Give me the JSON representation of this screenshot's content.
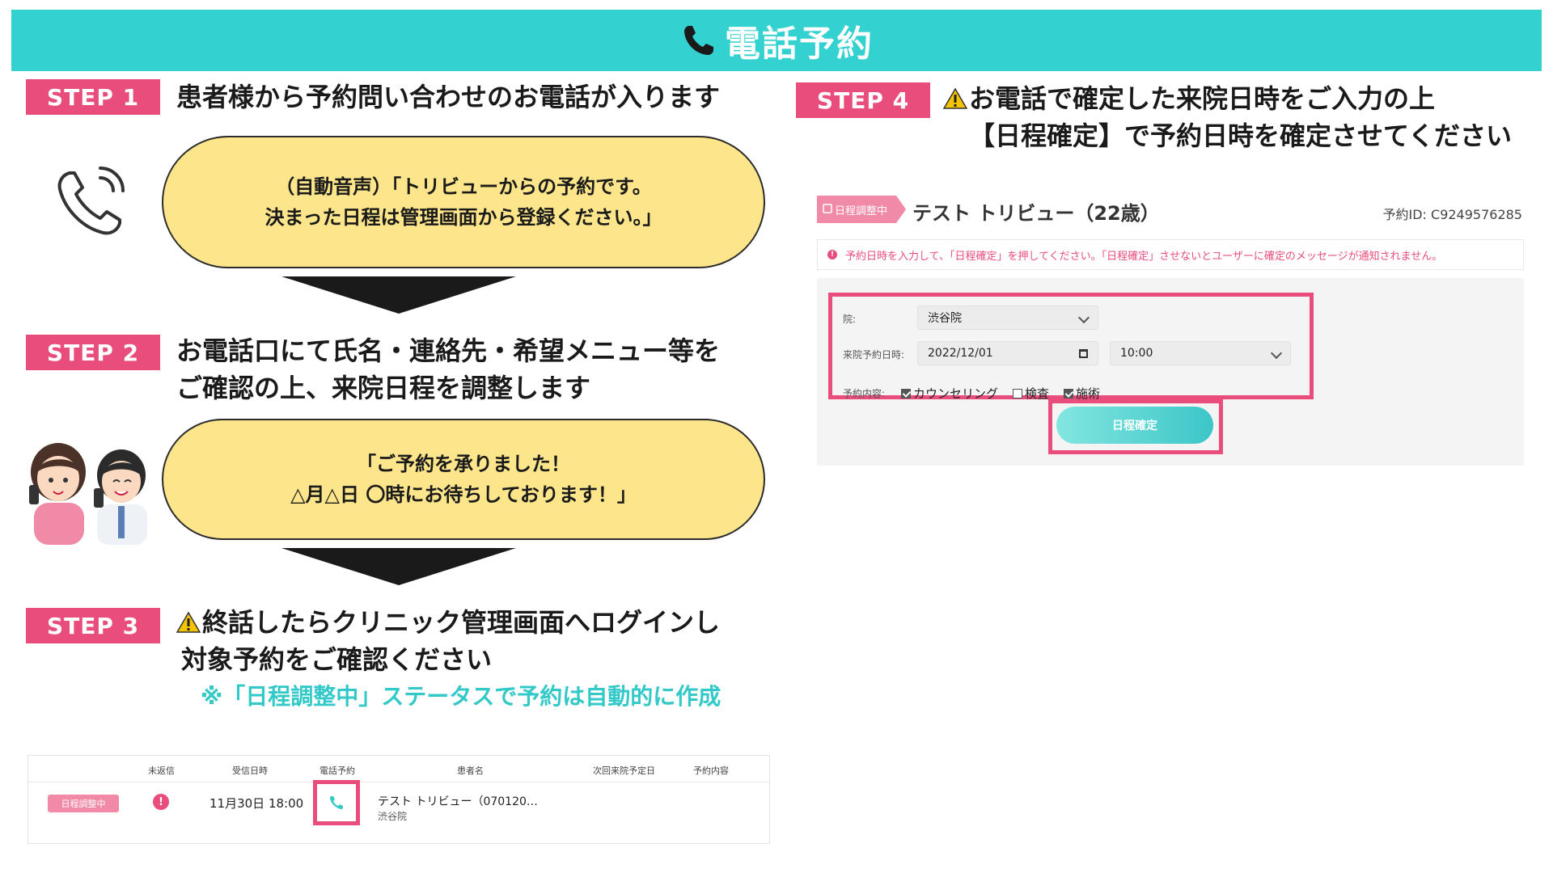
{
  "banner": {
    "title": "電話予約"
  },
  "steps": [
    {
      "badge": "STEP 1",
      "lines": [
        "患者様から予約問い合わせのお電話が入ります"
      ]
    },
    {
      "badge": "STEP 2",
      "lines": [
        "お電話口にて氏名・連絡先・希望メニュー等を",
        "ご確認の上、来院日程を調整します"
      ]
    },
    {
      "badge": "STEP 3",
      "lines": [
        "終話したらクリニック管理画面へログインし",
        "対象予約をご確認ください"
      ],
      "note": "※「日程調整中」ステータスで予約は自動的に作成"
    },
    {
      "badge": "STEP 4",
      "lines": [
        "お電話で確定した来院日時をご入力の上",
        "【日程確定】で予約日時を確定させてください"
      ]
    }
  ],
  "bubbles": [
    {
      "lines": [
        "（自動音声）「トリビューからの予約です。",
        "決まった日程は管理画面から登録ください。」"
      ]
    },
    {
      "lines": [
        "「ご予約を承りました！",
        "△月△日 〇時にお待ちしております！」"
      ]
    }
  ],
  "table": {
    "headers": [
      "未返信",
      "受信日時",
      "電話予約",
      "患者名",
      "次回来院予定日",
      "予約内容"
    ],
    "row": {
      "status": "日程調整中",
      "alert": "!",
      "received": "11月30日 18:00",
      "patient": "テスト トリビュー（070120…",
      "clinic": "渋谷院"
    }
  },
  "form": {
    "status_tag": "日程調整中",
    "patient_name": "テスト トリビュー（22歳）",
    "reservation_id": "予約ID: C9249576285",
    "alert_message": "予約日時を入力して、「日程確定」を押してください。「日程確定」させないとユーザーに確定のメッセージが通知されません。",
    "clinic_label": "院:",
    "clinic_value": "渋谷院",
    "date_label": "来院予約日時:",
    "date_value": "2022/12/01",
    "time_value": "10:00",
    "content_label": "予約内容:",
    "options": [
      {
        "label": "カウンセリング",
        "checked": true
      },
      {
        "label": "検査",
        "checked": false
      },
      {
        "label": "施術",
        "checked": true
      }
    ],
    "confirm_label": "日程確定"
  },
  "colors": {
    "teal": "#33d1cf",
    "pink": "#e94d7b",
    "bubble": "#fce58a"
  }
}
